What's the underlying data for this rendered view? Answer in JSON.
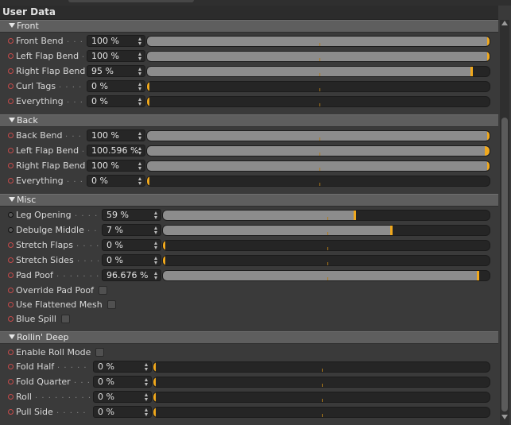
{
  "header": {
    "title": "User Data"
  },
  "colors": {
    "accent": "#f0a81c",
    "slider_fill": "#8c8c8c",
    "background": "#3a3a3a",
    "indicator": "#c84a4a"
  },
  "groups": [
    {
      "label": "Front",
      "rows": [
        {
          "label": "Front Bend",
          "value": "100 %",
          "fraction": 1.0,
          "indicator": "red"
        },
        {
          "label": "Left Flap Bend",
          "value": "100 %",
          "fraction": 1.0,
          "indicator": "red"
        },
        {
          "label": "Right Flap Bend",
          "value": "95 %",
          "fraction": 0.95,
          "indicator": "red"
        },
        {
          "label": "Curl Tags",
          "value": "0 %",
          "fraction": 0.0,
          "indicator": "red"
        },
        {
          "label": "Everything",
          "value": "0 %",
          "fraction": 0.0,
          "indicator": "red"
        }
      ]
    },
    {
      "label": "Back",
      "rows": [
        {
          "label": "Back Bend",
          "value": "100 %",
          "fraction": 1.0,
          "indicator": "red"
        },
        {
          "label": "Left Flap Bend",
          "value": "100.596 %",
          "fraction": 1.0,
          "overflow": true,
          "indicator": "red"
        },
        {
          "label": "Right Flap Bend",
          "value": "100 %",
          "fraction": 1.0,
          "indicator": "red"
        },
        {
          "label": "Everything",
          "value": "0 %",
          "fraction": 0.0,
          "indicator": "red"
        }
      ]
    },
    {
      "label": "Misc",
      "rows": [
        {
          "label": "Leg Opening",
          "value": "59 %",
          "fraction": 0.59,
          "indicator": "black"
        },
        {
          "label": "Debulge Middle",
          "value": "7 %",
          "fraction": 0.7,
          "indicator": "black"
        },
        {
          "label": "Stretch Flaps",
          "value": "0 %",
          "fraction": 0.0,
          "indicator": "red"
        },
        {
          "label": "Stretch Sides",
          "value": "0 %",
          "fraction": 0.0,
          "indicator": "red"
        },
        {
          "label": "Pad Poof",
          "value": "96.676 %",
          "fraction": 0.967,
          "indicator": "red"
        }
      ],
      "checks": [
        {
          "label": "Override Pad Poof",
          "checked": false
        },
        {
          "label": "Use Flattened Mesh",
          "checked": false
        },
        {
          "label": "Blue Spill",
          "checked": false
        }
      ]
    },
    {
      "label": "Rollin' Deep",
      "checks_first": [
        {
          "label": "Enable Roll Mode",
          "checked": false
        }
      ],
      "rows": [
        {
          "label": "Fold Half",
          "value": "0 %",
          "fraction": 0.0,
          "indicator": "red"
        },
        {
          "label": "Fold Quarter",
          "value": "0 %",
          "fraction": 0.0,
          "indicator": "red"
        },
        {
          "label": "Roll",
          "value": "0 %",
          "fraction": 0.0,
          "indicator": "red"
        },
        {
          "label": "Pull Side",
          "value": "0 %",
          "fraction": 0.0,
          "indicator": "red"
        }
      ]
    }
  ]
}
